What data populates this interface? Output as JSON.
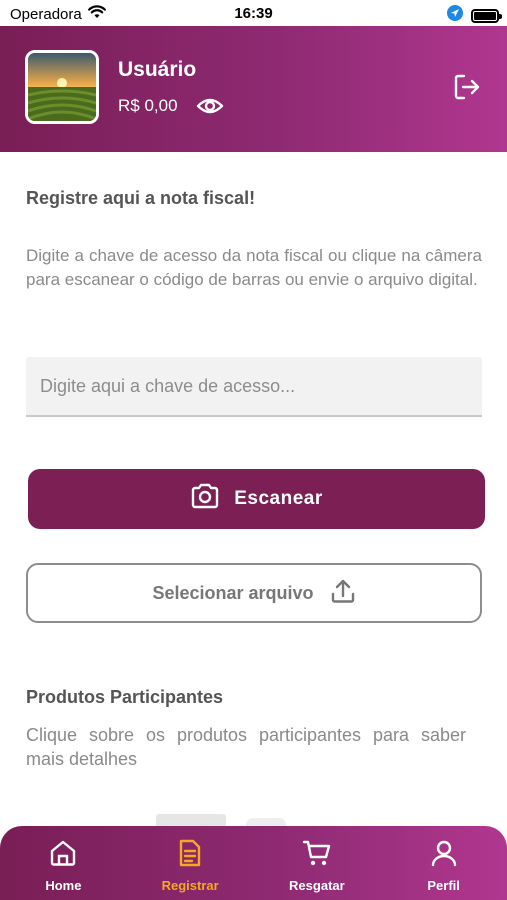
{
  "status_bar": {
    "carrier": "Operadora",
    "time": "16:39"
  },
  "header": {
    "user_name": "Usuário",
    "balance": "R$ 0,00"
  },
  "register": {
    "title": "Registre aqui a nota fiscal!",
    "description": "Digite a chave de acesso da nota fiscal ou clique na câmera para escanear o código de barras ou envie o arquivo digital.",
    "key_placeholder": "Digite aqui a chave de acesso...",
    "key_value": "",
    "scan_label": "Escanear",
    "select_file_label": "Selecionar arquivo"
  },
  "products": {
    "title": "Produtos Participantes",
    "description": "Clique sobre os produtos participantes para saber mais detalhes"
  },
  "bottom_nav": {
    "items": [
      {
        "label": "Home",
        "icon": "home-icon",
        "active": false
      },
      {
        "label": "Registrar",
        "icon": "document-icon",
        "active": true
      },
      {
        "label": "Resgatar",
        "icon": "cart-icon",
        "active": false
      },
      {
        "label": "Perfil",
        "icon": "user-icon",
        "active": false
      }
    ],
    "active_color": "#f6a821"
  },
  "colors": {
    "brand": "#7b1f55",
    "brand_light": "#b0378f",
    "accent": "#f6a821"
  }
}
